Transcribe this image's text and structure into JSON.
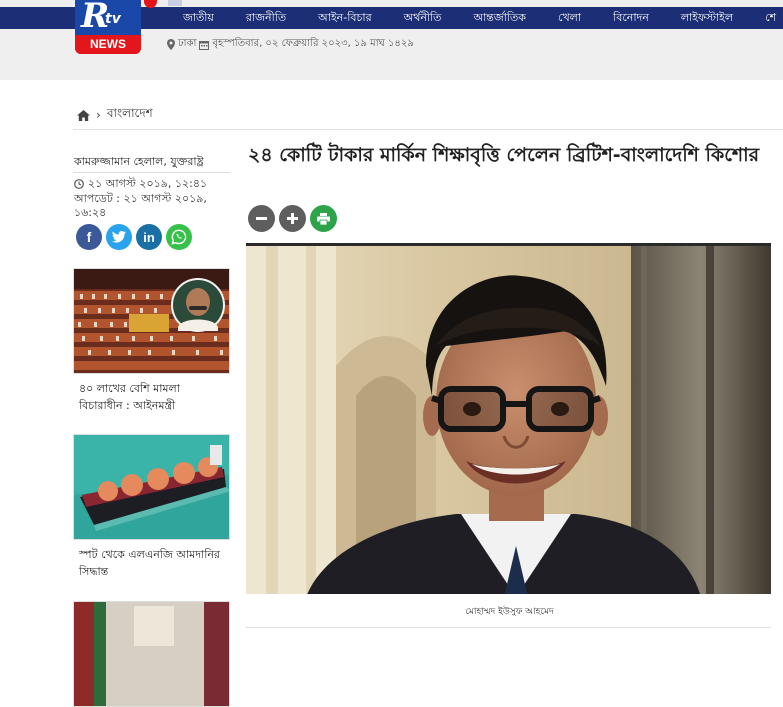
{
  "site": {
    "logo_text": "Rtv",
    "logo_badge": "NEWS",
    "nav": [
      "জাতীয়",
      "রাজনীতি",
      "আইন-বিচার",
      "অর্থনীতি",
      "আন্তর্জাতিক",
      "খেলা",
      "বিনোদন",
      "লাইফস্টাইল",
      "শে"
    ],
    "dateline": "ঢাকা",
    "date": "বৃহস্পতিবার, ০২ ফেব্রুয়ারি ২০২৩, ১৯ মাঘ ১৪২৯"
  },
  "breadcrumb": {
    "home_icon": "home-icon",
    "section": "বাংলাদেশ"
  },
  "article": {
    "author": "কামরুজ্জামান হেলাল, যুক্তরাষ্ট্র",
    "published": "২১ আগস্ট ২০১৯, ১২:৪১",
    "updated_label": "আপডেট :",
    "updated": "২১ আগস্ট ২০১৯, ১৬:২৪",
    "headline": "২৪ কোটি টাকার মার্কিন শিক্ষাবৃত্তি পেলেন ব্রিটিশ-বাংলাদেশি কিশোর",
    "photo_caption": "মোহাম্মদ ইউসুফ আহমেদ",
    "tools": [
      "minus-icon",
      "plus-icon",
      "print-icon"
    ]
  },
  "social": [
    {
      "name": "facebook",
      "glyph": "f"
    },
    {
      "name": "twitter",
      "glyph": ""
    },
    {
      "name": "linkedin",
      "glyph": "in"
    },
    {
      "name": "whatsapp",
      "glyph": ""
    }
  ],
  "related": [
    {
      "title": "৪০ লাখের বেশি মামলা বিচারাধীন : আইনমন্ত্রী"
    },
    {
      "title": "স্পট থেকে এলএনজি আমদানির সিদ্ধান্ত"
    },
    {
      "title": ""
    }
  ],
  "colors": {
    "nav_bg": "#1c2f76",
    "logo_blue": "#1a48a8",
    "logo_red": "#e4161b",
    "whatsapp": "#35c14a",
    "print": "#2ea44a"
  }
}
